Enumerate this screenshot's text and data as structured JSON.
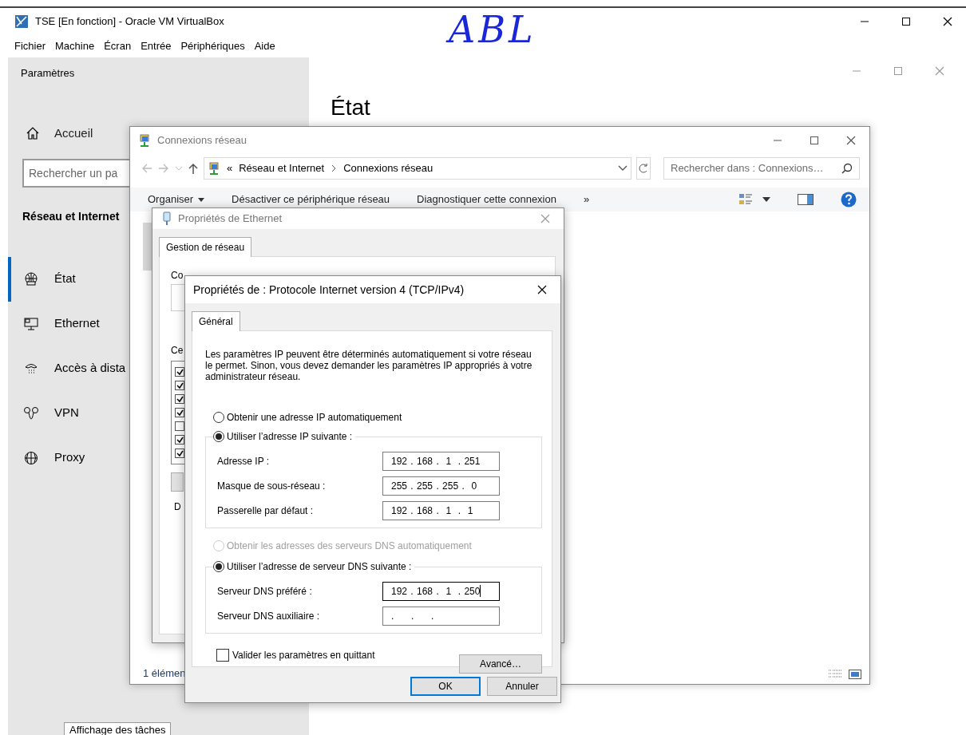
{
  "vm_window": {
    "title": "TSE [En fonction] - Oracle VM VirtualBox",
    "menu": [
      "Fichier",
      "Machine",
      "Écran",
      "Entrée",
      "Périphériques",
      "Aide"
    ],
    "annotation": "ABL"
  },
  "settings": {
    "title": "Paramètres",
    "home": "Accueil",
    "search_placeholder": "Rechercher un pa",
    "section": "Réseau et Internet",
    "nav": [
      {
        "kind": "status",
        "label": "État",
        "selected": true
      },
      {
        "kind": "ethernet",
        "label": "Ethernet",
        "selected": false
      },
      {
        "kind": "dialup",
        "label": "Accès à dista",
        "selected": false
      },
      {
        "kind": "vpn",
        "label": "VPN",
        "selected": false
      },
      {
        "kind": "proxy",
        "label": "Proxy",
        "selected": false
      }
    ],
    "page_title": "État",
    "taskbar_button": "Affichage des tâches"
  },
  "network_connections": {
    "title": "Connexions réseau",
    "overflow": "«",
    "breadcrumb": [
      "Réseau et Internet",
      "Connexions réseau"
    ],
    "search_placeholder": "Rechercher dans : Connexions…",
    "toolbar": [
      {
        "label": "Organiser",
        "dropdown": true
      },
      {
        "label": "Désactiver ce périphérique réseau",
        "dropdown": false
      },
      {
        "label": "Diagnostiquer cette connexion",
        "dropdown": false
      },
      {
        "label": "»",
        "dropdown": false
      }
    ],
    "status": "1 élémen"
  },
  "ethernet_properties": {
    "title": "Propriétés de Ethernet",
    "tabs": [
      {
        "label": "Gestion de réseau",
        "selected": true
      }
    ],
    "connect_label": "Co",
    "components_label": "Ce",
    "description_label": "D",
    "components": [
      {
        "checked": true
      },
      {
        "checked": true
      },
      {
        "checked": true
      },
      {
        "checked": true
      },
      {
        "checked": false
      },
      {
        "checked": true
      },
      {
        "checked": true
      }
    ]
  },
  "ipv4_dialog": {
    "title": "Propriétés de : Protocole Internet version 4 (TCP/IPv4)",
    "tabs": [
      {
        "label": "Général",
        "selected": true
      }
    ],
    "intro": "Les paramètres IP peuvent être déterminés automatiquement si votre réseau le permet. Sinon, vous devez demander les paramètres IP appropriés à votre administrateur réseau.",
    "ip_auto": {
      "label": "Obtenir une adresse IP automatiquement",
      "selected": false,
      "disabled": false
    },
    "ip_manual": {
      "label": "Utiliser l’adresse IP suivante :",
      "selected": true,
      "disabled": false
    },
    "ip_fields": [
      {
        "label": "Adresse IP :",
        "value": "192 . 168 .  1  . 251",
        "focused": false
      },
      {
        "label": "Masque de sous-réseau :",
        "value": "255 . 255 . 255 .  0",
        "focused": false
      },
      {
        "label": "Passerelle par défaut :",
        "value": "192 . 168 .  1  .  1",
        "focused": false
      }
    ],
    "dns_auto": {
      "label": "Obtenir les adresses des serveurs DNS automatiquement",
      "selected": false,
      "disabled": true
    },
    "dns_manual": {
      "label": "Utiliser l’adresse de serveur DNS suivante :",
      "selected": true,
      "disabled": false
    },
    "dns_fields": [
      {
        "label": "Serveur DNS préféré :",
        "value": "192 . 168 .  1  . 250",
        "focused": true
      },
      {
        "label": "Serveur DNS auxiliaire :",
        "value": ".     .     .",
        "focused": false
      }
    ],
    "validate": {
      "label": "Valider les paramètres en quittant",
      "checked": false
    },
    "advanced": "Avancé…",
    "buttons": [
      {
        "label": "OK",
        "default": true
      },
      {
        "label": "Annuler",
        "default": false
      }
    ]
  }
}
